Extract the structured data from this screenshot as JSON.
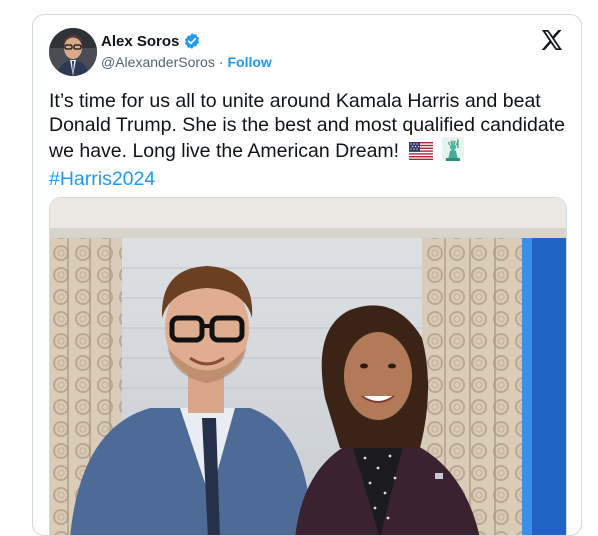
{
  "tweet": {
    "author_name": "Alex Soros",
    "handle": "@AlexanderSoros",
    "separator": "·",
    "follow_label": "Follow",
    "text": "It’s time for us all to unite around Kamala Harris and beat Donald Trump. She is the best and most qualified candidate we have. Long live the American Dream!",
    "emojis": [
      "us-flag-icon",
      "statue-of-liberty-icon"
    ],
    "hashtag": "#Harris2024",
    "verified_icon": "verified-badge-icon",
    "platform_icon": "x-logo-icon"
  },
  "colors": {
    "accent": "#1d9bf0",
    "text": "#0f1419",
    "muted": "#536471",
    "border": "#cfd9de"
  }
}
